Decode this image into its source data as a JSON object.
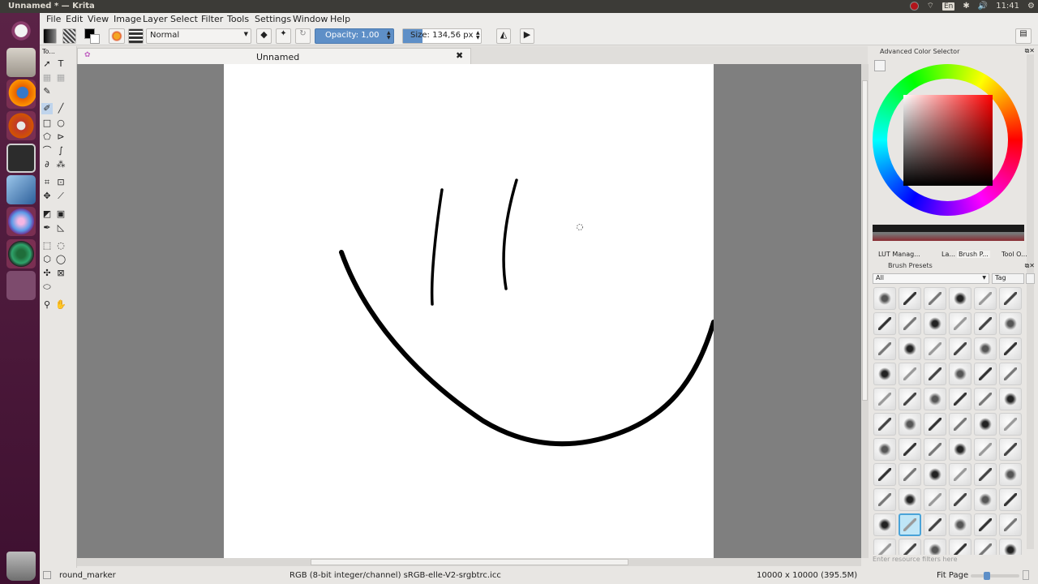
{
  "window": {
    "title": "Unnamed * — Krita"
  },
  "tray": {
    "keyboard": "En",
    "time": "11:41"
  },
  "menu": [
    "File",
    "Edit",
    "View",
    "Image",
    "Layer",
    "Select",
    "Filter",
    "Tools",
    "Settings",
    "Window",
    "Help"
  ],
  "toolbar": {
    "blend_mode": "Normal",
    "opacity_label": "Opacity:  1,00",
    "size_label": "Size: 134,56 px",
    "size_fill": 0.25
  },
  "document": {
    "tab_title": "Unnamed"
  },
  "dockers": {
    "color_selector_title": "Advanced Color Selector",
    "tabs": [
      "LUT Manag...",
      "La...",
      "Brush P...",
      "Tool O..."
    ],
    "brush_presets_title": "Brush Presets",
    "filter_value": "All",
    "tag_label": "Tag",
    "search_placeholder": "Enter resource filters here"
  },
  "status": {
    "brush": "round_marker",
    "color_info": "RGB (8-bit integer/channel)  sRGB-elle-V2-srgbtrc.icc",
    "doc_size": "10000 x 10000 (395.5M)",
    "zoom": "Fit Page",
    "zoom_level": 0.3
  },
  "colors": {
    "launcher": "#5b2346",
    "accent": "#5e8fc7",
    "canvas_bg": "#7f7f7f"
  }
}
